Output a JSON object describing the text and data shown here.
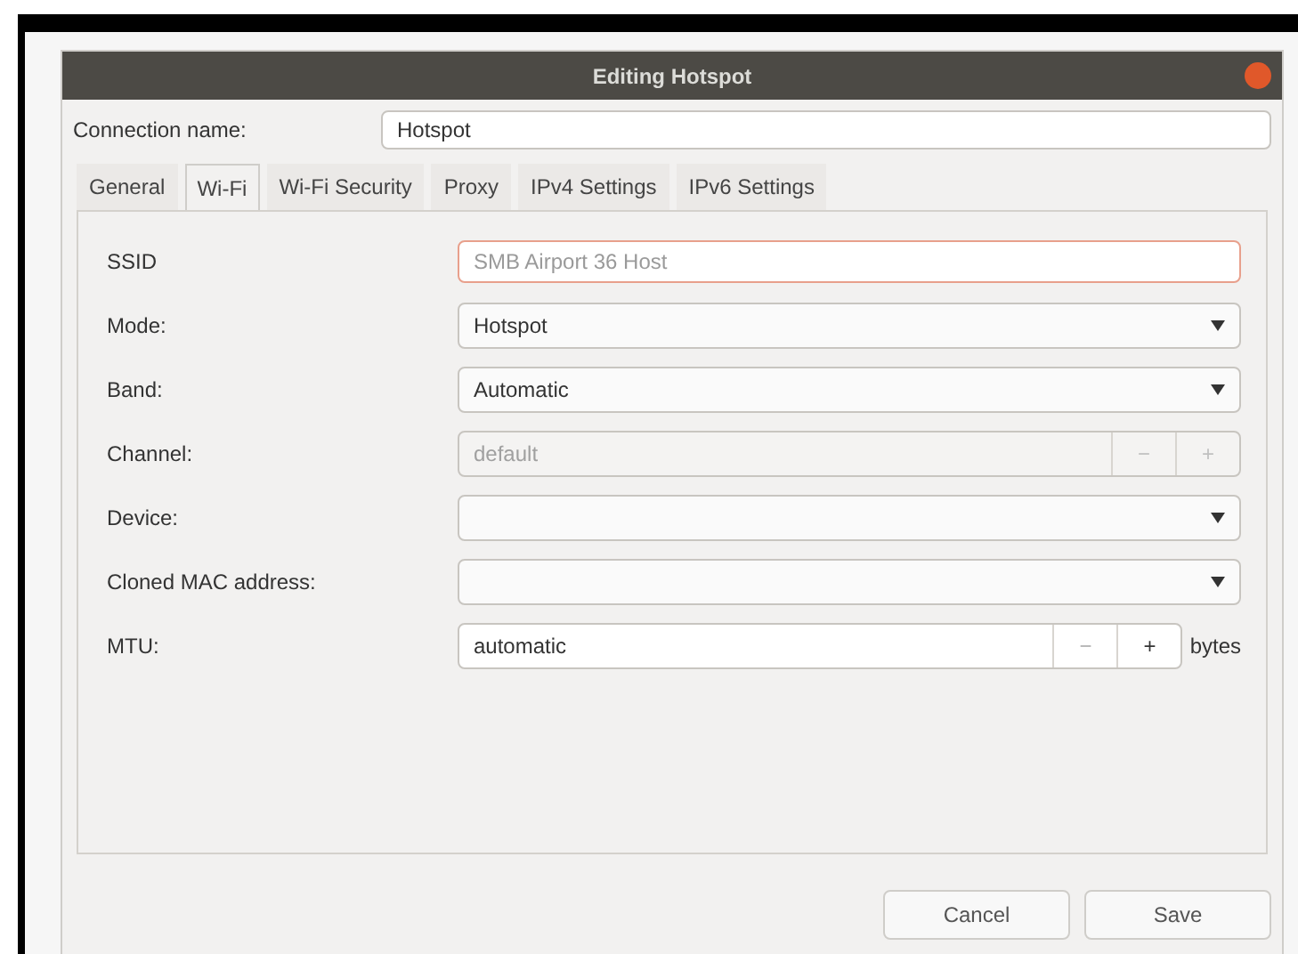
{
  "window": {
    "title": "Editing Hotspot"
  },
  "connection_name": {
    "label": "Connection name:",
    "value": "Hotspot"
  },
  "tabs": [
    {
      "label": "General",
      "selected": false
    },
    {
      "label": "Wi-Fi",
      "selected": true
    },
    {
      "label": "Wi-Fi Security",
      "selected": false
    },
    {
      "label": "Proxy",
      "selected": false
    },
    {
      "label": "IPv4 Settings",
      "selected": false
    },
    {
      "label": "IPv6 Settings",
      "selected": false
    }
  ],
  "rows": [
    {
      "kind": "text",
      "label": "SSID",
      "placeholder": "SMB Airport 36 Host",
      "invalid": true,
      "disabled": false
    },
    {
      "kind": "combo",
      "label": "Mode:",
      "value": "Hotspot",
      "disabled": false
    },
    {
      "kind": "combo",
      "label": "Band:",
      "value": "Automatic",
      "disabled": false
    },
    {
      "kind": "spin",
      "label": "Channel:",
      "value": "default",
      "minus": "−",
      "plus": "+",
      "disabled": true
    },
    {
      "kind": "combo",
      "label": "Device:",
      "value": "",
      "disabled": false
    },
    {
      "kind": "combo",
      "label": "Cloned MAC address:",
      "value": "",
      "disabled": false
    },
    {
      "kind": "spin",
      "label": "MTU:",
      "value": "automatic",
      "minus": "−",
      "plus": "+",
      "unit": "bytes",
      "disabled": false
    }
  ],
  "buttons": [
    "Cancel",
    "Save"
  ]
}
